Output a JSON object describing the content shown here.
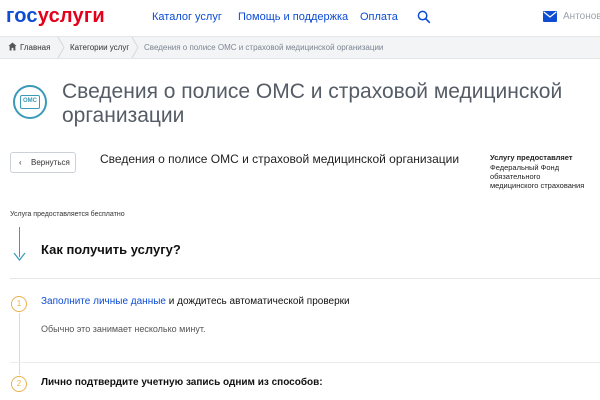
{
  "header": {
    "logo_part1": "гос",
    "logo_part2": "услуги",
    "nav": [
      {
        "label": "Каталог услуг"
      },
      {
        "label": "Помощь и поддержка"
      },
      {
        "label": "Оплата"
      }
    ],
    "user_name": "Антонова",
    "accent_color": "#0d4cd3",
    "logo_red": "#e3001b"
  },
  "breadcrumbs": {
    "home": "Главная",
    "category": "Категории услуг",
    "current": "Сведения о полисе ОМС и страховой медицинской организации"
  },
  "hero": {
    "badge_text": "ОМС",
    "title": "Сведения о полисе ОМС и страховой медицинской организации"
  },
  "service": {
    "back_label": "Вернуться",
    "title": "Сведения о полисе ОМС и страховой медицинской организации",
    "provider_heading": "Услугу предоставляет",
    "provider_name": "Федеральный Фонд обязательного медицинского страхования",
    "free_note": "Услуга предоставляется бесплатно"
  },
  "howto": {
    "heading": "Как получить услугу?",
    "steps": [
      {
        "number": "1",
        "link_text": "Заполните личные данные",
        "rest_text": " и дождитесь автоматической проверки",
        "description": "Обычно это занимает несколько минут."
      },
      {
        "number": "2",
        "title": "Лично подтвердите учетную запись одним из способов:"
      }
    ],
    "step_color": "#e9b24f",
    "arrow_color": "#3a9ab7"
  }
}
